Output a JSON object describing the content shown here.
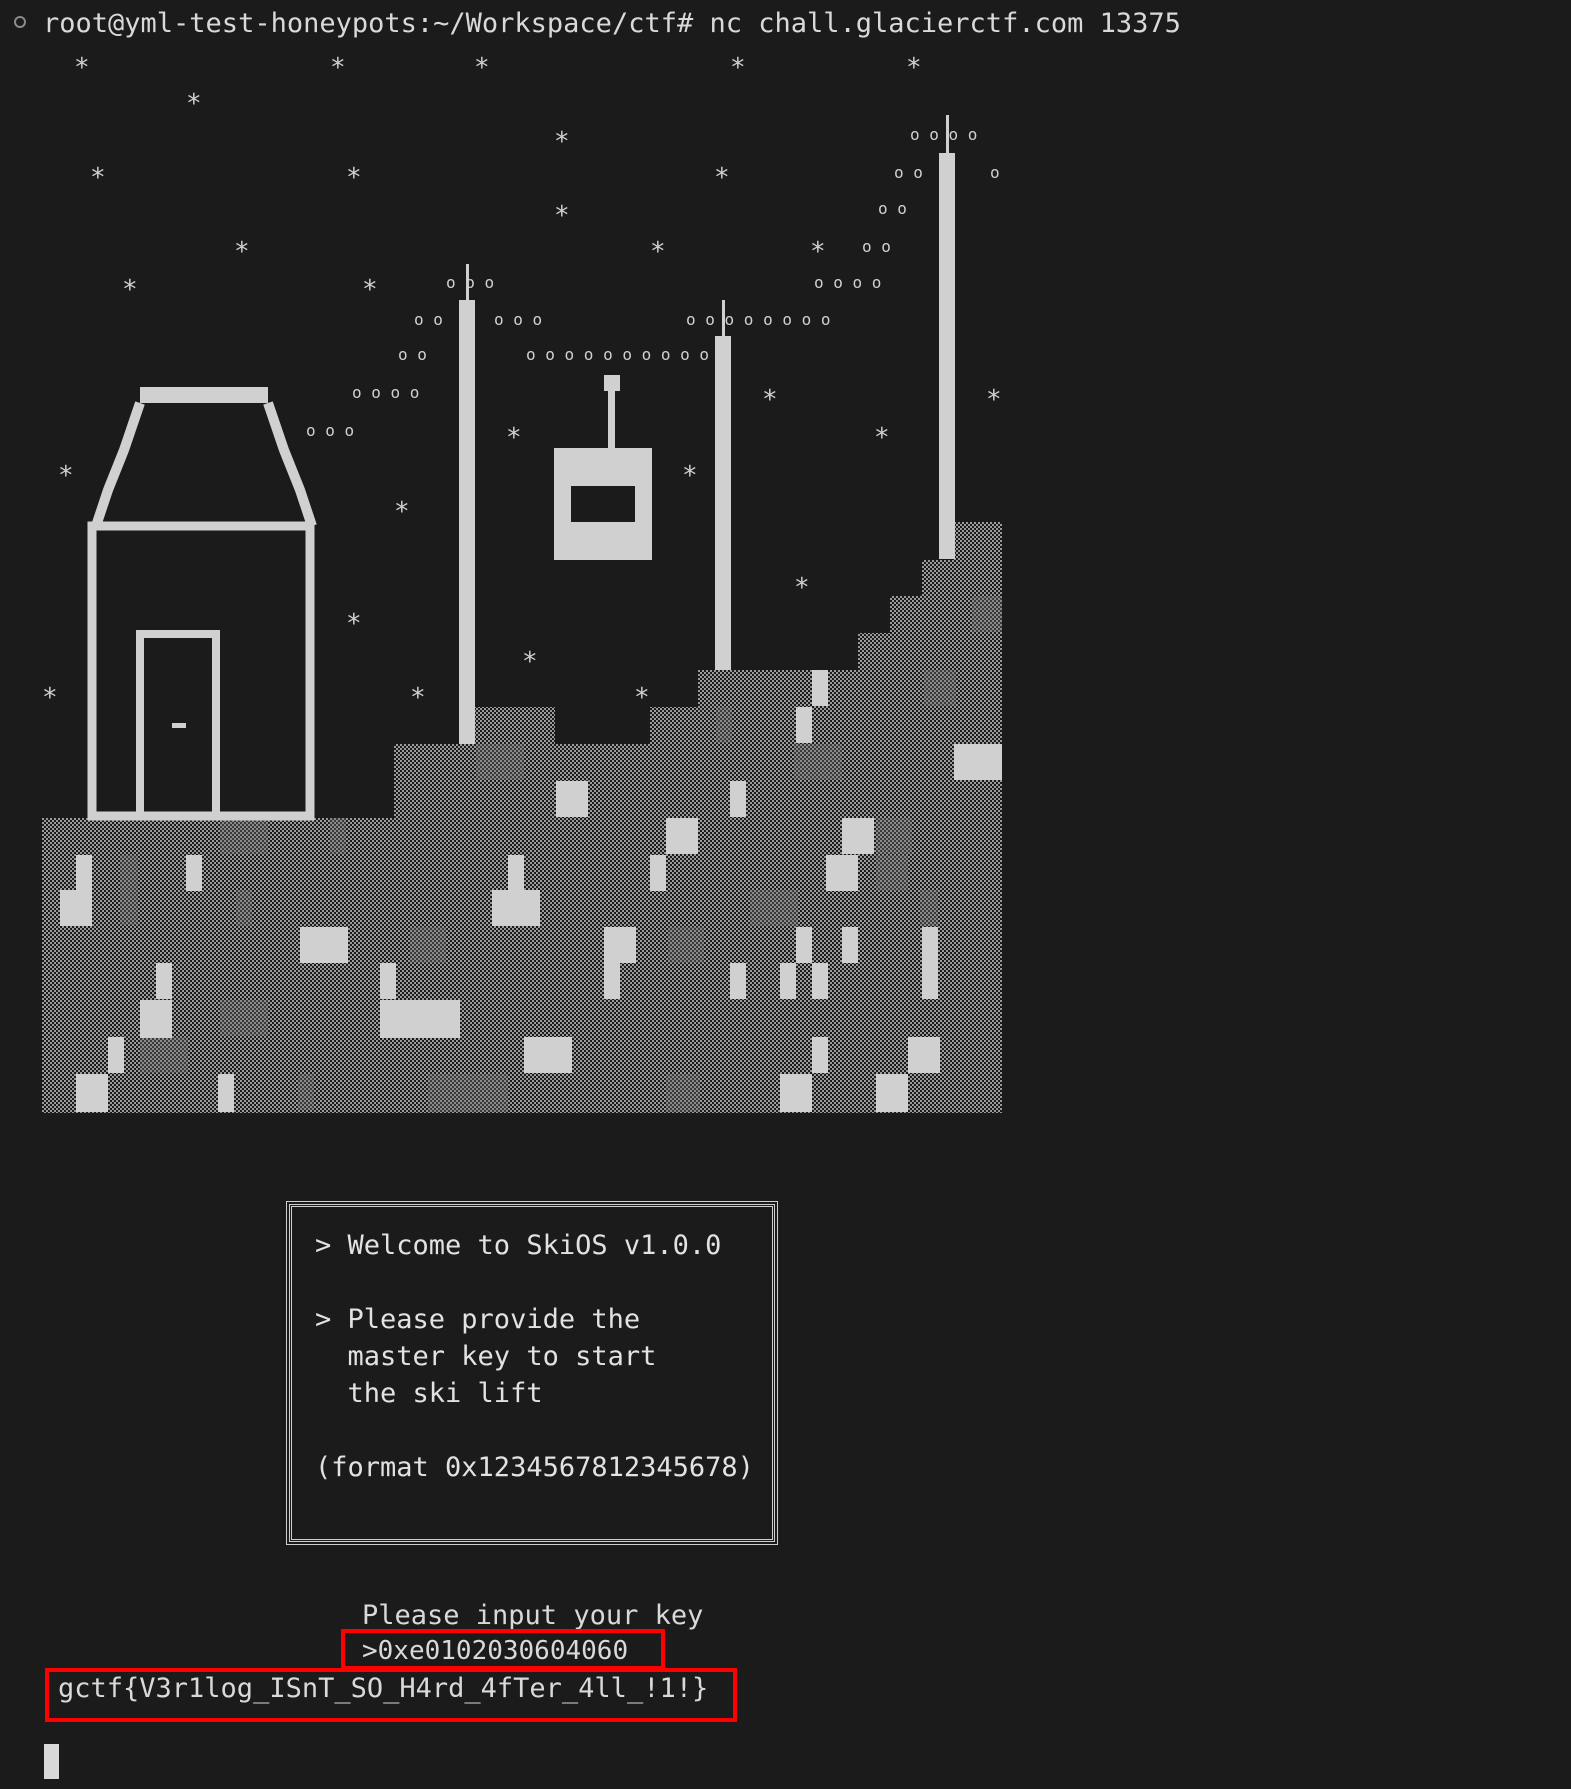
{
  "terminal": {
    "prompt_line": "root@yml-test-honeypots:~/Workspace/ctf# nc chall.glacierctf.com 13375",
    "dialog": {
      "welcome": "> Welcome to SkiOS v1.0.0",
      "request_1": "> Please provide the",
      "request_2": "  master key to start",
      "request_3": "  the ski lift",
      "format_hint": "(format 0x1234567812345678)"
    },
    "input_prompt": "Please input your key",
    "input_value": ">0xe0102030604060",
    "flag_output": "gctf{V3r1log_ISnT_SO_H4rd_4fTer_4ll_!1!}"
  },
  "colors": {
    "background": "#1b1b1b",
    "text": "#d9d9d9",
    "art": "#d0d0d0",
    "highlight": "#ff0000"
  },
  "icons": {
    "prompt_status": "circle-status-icon",
    "ascii_scene": "ski-lift-ascii-art",
    "cursor": "block-cursor-icon"
  }
}
